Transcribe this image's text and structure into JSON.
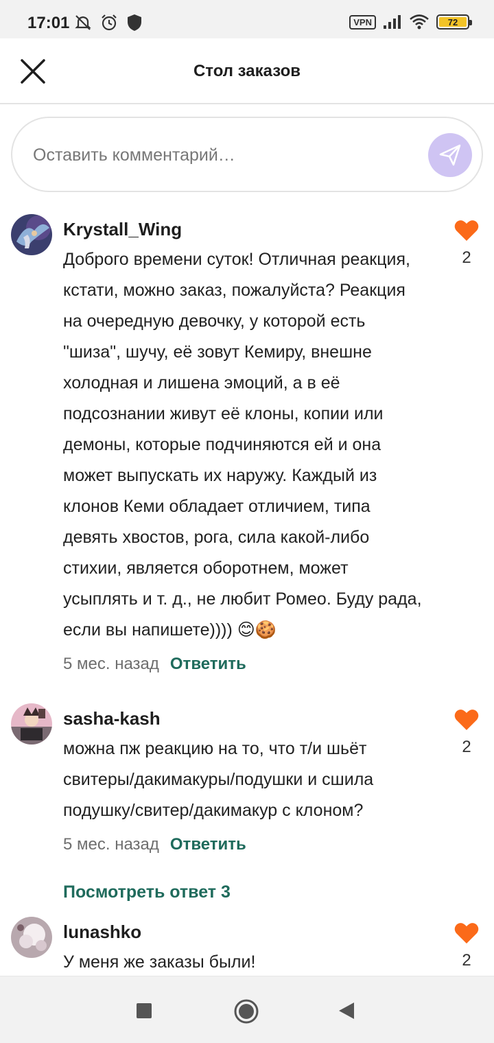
{
  "status": {
    "time": "17:01",
    "vpn": "VPN",
    "battery": "72",
    "left_icons": [
      "do-not-disturb-icon",
      "alarm-icon",
      "shield-icon"
    ],
    "right_icons": [
      "vpn-icon",
      "signal-icon",
      "wifi-icon",
      "battery-icon"
    ]
  },
  "header": {
    "title": "Стол заказов",
    "close_icon": "close-icon"
  },
  "compose": {
    "placeholder": "Оставить комментарий…",
    "send_icon": "send-icon"
  },
  "comments": [
    {
      "username": "Krystall_Wing",
      "text": "Доброго времени суток! Отличная реакция, кстати, можно заказ, пожалуйста? Реакция на очередную девочку, у которой есть \"шиза\", шучу, её зовут Кемиру, внешне холодная и лишена эмоций, а в её подсознании живут её клоны, копии или демоны, которые подчиняются ей и она может выпускать их наружу. Каждый из клонов Кеми обладает отличием, типа девять хвостов, рога, сила какой-либо стихии, является оборотнем, может усыплять и т. д., не любит Ромео. Буду рада, если вы напишете)))) 😊🍪",
      "time": "5 мес. назад",
      "reply": "Ответить",
      "likes": "2"
    },
    {
      "username": "sasha-kash",
      "text": "можна пж реакцию на то, что т/и шьёт свитеры/дакимакуры/подушки и сшила подушку/свитер/дакимакур с клоном?",
      "time": "5 мес. назад",
      "reply": "Ответить",
      "likes": "2",
      "view_replies": "Посмотреть ответ 3"
    },
    {
      "username": "lunashko",
      "text": "У меня же заказы были!",
      "likes": "2"
    }
  ],
  "colors": {
    "accent": "#1f6b5c",
    "like": "#fb6a19",
    "send_button": "#cfc4f3"
  },
  "nav": {
    "recents_icon": "square-icon",
    "home_icon": "circle-icon",
    "back_icon": "triangle-back-icon"
  }
}
